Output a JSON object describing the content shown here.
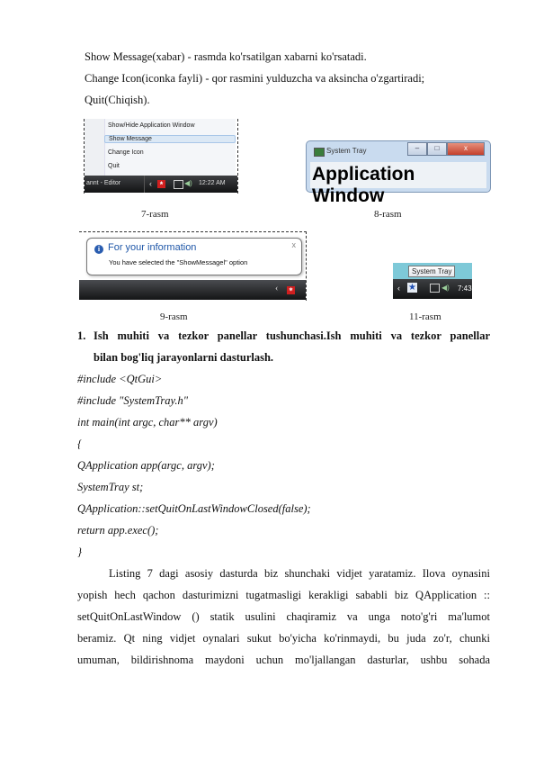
{
  "intro_lines": [
    "Show Message(xabar) - rasmda ko'rsatilgan xabarni ko'rsatadi.",
    "Change Icon(iconka fayli) - qor rasmini yulduzcha va aksincha o'zgartiradi;",
    "Quit(Chiqish)."
  ],
  "figures": {
    "fig7": {
      "menu_items": [
        "Show/Hide Application Window",
        "Show Message",
        "Change Icon",
        "Quit"
      ],
      "selected_item": "Show Message",
      "taskbar_app": "annt - Editor",
      "clock": "12:22 AM",
      "caption": "7-rasm"
    },
    "fig8": {
      "window_title": "System Tray",
      "minimize": "–",
      "maximize": "□",
      "close": "x",
      "content_text": "Application Window",
      "caption": "8-rasm"
    },
    "fig9": {
      "balloon_title": "For your information",
      "balloon_message": "You have selected the \"ShowMessagel\" option",
      "close": "x",
      "caption": "9-rasm"
    },
    "fig11": {
      "tooltip": "System Tray",
      "clock": "7:43",
      "caption": "11-rasm"
    }
  },
  "section": {
    "number": "1.",
    "heading_line1": "Ish muhiti va tezkor panellar tushunchasi.Ish muhiti va tezkor panellar",
    "heading_line2": "bilan bog'liq jarayonlarni dasturlash."
  },
  "code_lines": [
    "#include <QtGui>",
    "#include \"SystemTray.h\"",
    "int main(int argc, char** argv)",
    "{",
    "QApplication app(argc, argv);",
    "SystemTray st;",
    "QApplication::setQuitOnLastWindowClosed(false);",
    "return app.exec();",
    "}"
  ],
  "paragraph_lines": [
    "Listing 7 dagi asosiy dasturda biz shunchaki vidjet yaratamiz. Ilova oynasini",
    "yopish hech qachon dasturimizni tugatmasligi kerakligi sababli biz QApplication ::",
    "setQuitOnLastWindow () statik usulini chaqiramiz va unga noto'g'ri ma'lumot",
    "beramiz. Qt ning vidjet oynalari sukut bo'yicha ko'rinmaydi, bu juda zo'r, chunki",
    "umuman, bildirishnoma maydoni uchun mo'ljallangan dasturlar, ushbu sohada"
  ]
}
